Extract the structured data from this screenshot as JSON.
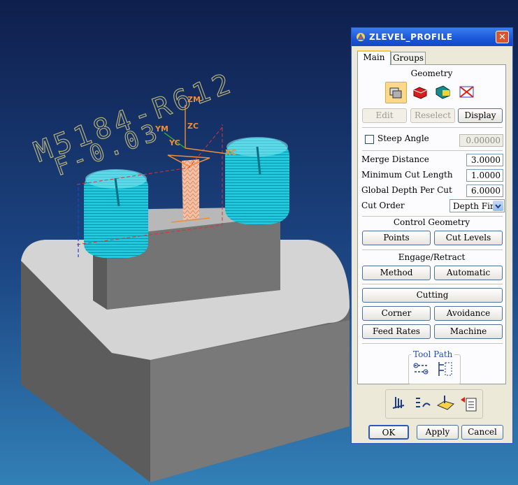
{
  "dialog": {
    "title": "ZLEVEL_PROFILE",
    "tabs": [
      "Main",
      "Groups"
    ],
    "geometry": {
      "section": "Geometry",
      "edit": "Edit",
      "reselect": "Reselect",
      "display": "Display"
    },
    "steep_angle": {
      "label": "Steep Angle",
      "checked": false,
      "value": "0.00000"
    },
    "fields": [
      {
        "label": "Merge Distance",
        "value": "3.0000"
      },
      {
        "label": "Minimum Cut Length",
        "value": "1.0000"
      },
      {
        "label": "Global Depth Per Cut",
        "value": "6.0000"
      }
    ],
    "cut_order": {
      "label": "Cut Order",
      "value": "Depth First"
    },
    "control_geometry": {
      "section": "Control Geometry",
      "points": "Points",
      "cut_levels": "Cut Levels"
    },
    "engage_retract": {
      "section": "Engage/Retract",
      "method": "Method",
      "automatic": "Automatic"
    },
    "cutting_buttons": {
      "cutting": "Cutting",
      "corner": "Corner",
      "avoidance": "Avoidance",
      "feed_rates": "Feed Rates",
      "machine": "Machine"
    },
    "tool_path": {
      "section": "Tool Path"
    },
    "footer": {
      "ok": "OK",
      "apply": "Apply",
      "cancel": "Cancel"
    }
  },
  "scene": {
    "engraving": [
      "M5184-R612",
      "F-0.03"
    ],
    "axes": {
      "zm": "ZM",
      "zc": "ZC",
      "ym": "YM",
      "yc": "YC",
      "xc": "XC"
    }
  },
  "colors": {
    "background_top": "#122456",
    "background_bottom": "#2f78b0",
    "toolpath": "#2ad8e8",
    "part": "#b8b8b8"
  }
}
